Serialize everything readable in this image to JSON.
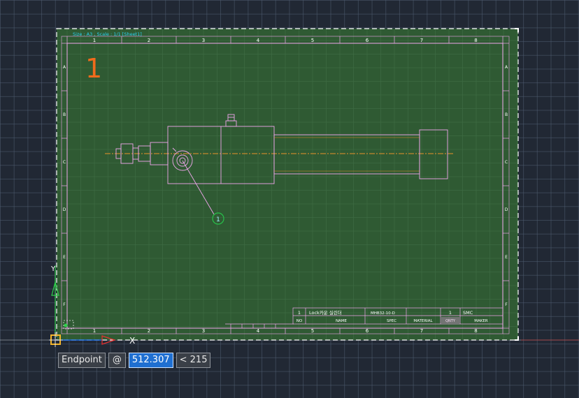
{
  "layout_tab": {
    "title": "Size : A3 , Scale : 1/1 [Sheet1]"
  },
  "sheet": {
    "number": "1",
    "col_labels": [
      "1",
      "2",
      "3",
      "4",
      "5",
      "6",
      "7",
      "8"
    ],
    "row_labels": [
      "A",
      "B",
      "C",
      "D",
      "E",
      "F"
    ],
    "balloon": "1"
  },
  "title_block": {
    "row": {
      "no": "1",
      "name": "Lock카운 실린더",
      "spec": "MHB32-10-D",
      "qty": "1",
      "maker": "SMC"
    },
    "headers": {
      "no": "NO",
      "name": "NAME",
      "spec": "SPEC",
      "material": "MATERIAL",
      "qty": "QNTY",
      "maker": "MAKER"
    }
  },
  "osnap": {
    "label": "Endpoint"
  },
  "dynamic_input": {
    "at": "@",
    "distance": "512.307",
    "angle": "< 215"
  },
  "colors": {
    "sheet": "#2f5a33",
    "drawing": "#f0a6ec",
    "center_line": "#e8922a",
    "border": "#ffffff"
  }
}
